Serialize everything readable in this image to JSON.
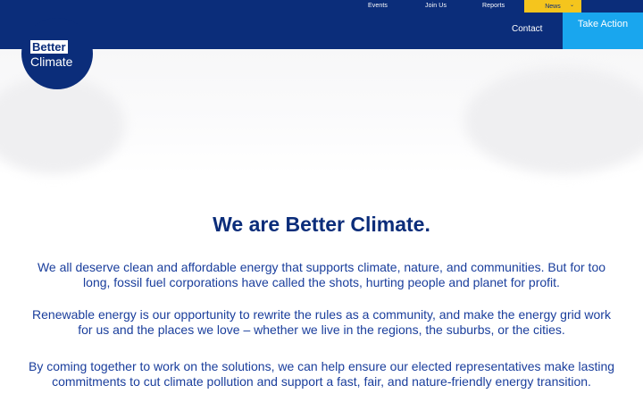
{
  "header": {
    "utility_nav": [
      {
        "label": "Events"
      },
      {
        "label": "Join Us"
      },
      {
        "label": "Reports"
      }
    ],
    "news_label": "News",
    "contact_label": "Contact",
    "take_action_label": "Take Action",
    "logo": {
      "line1": "Better",
      "line2": "Climate"
    }
  },
  "main": {
    "headline": "We are Better Climate.",
    "paragraphs": [
      "We all deserve clean and affordable energy that supports climate, nature, and communities. But for too long, fossil fuel corporations have called the shots, hurting people and planet for profit.",
      "Renewable energy is our opportunity to rewrite the rules as a community, and make the energy grid work for us and the places we love – whether we live in the regions, the suburbs, or the cities.",
      "By coming together to work on the solutions, we can help ensure our elected representatives make lasting commitments to cut climate pollution and support a fast, fair, and nature-friendly energy transition."
    ]
  },
  "colors": {
    "brand_navy": "#0b2d7a",
    "accent_yellow": "#f5c51d",
    "accent_blue": "#19a6ee",
    "body_text": "#1a3e9c"
  }
}
